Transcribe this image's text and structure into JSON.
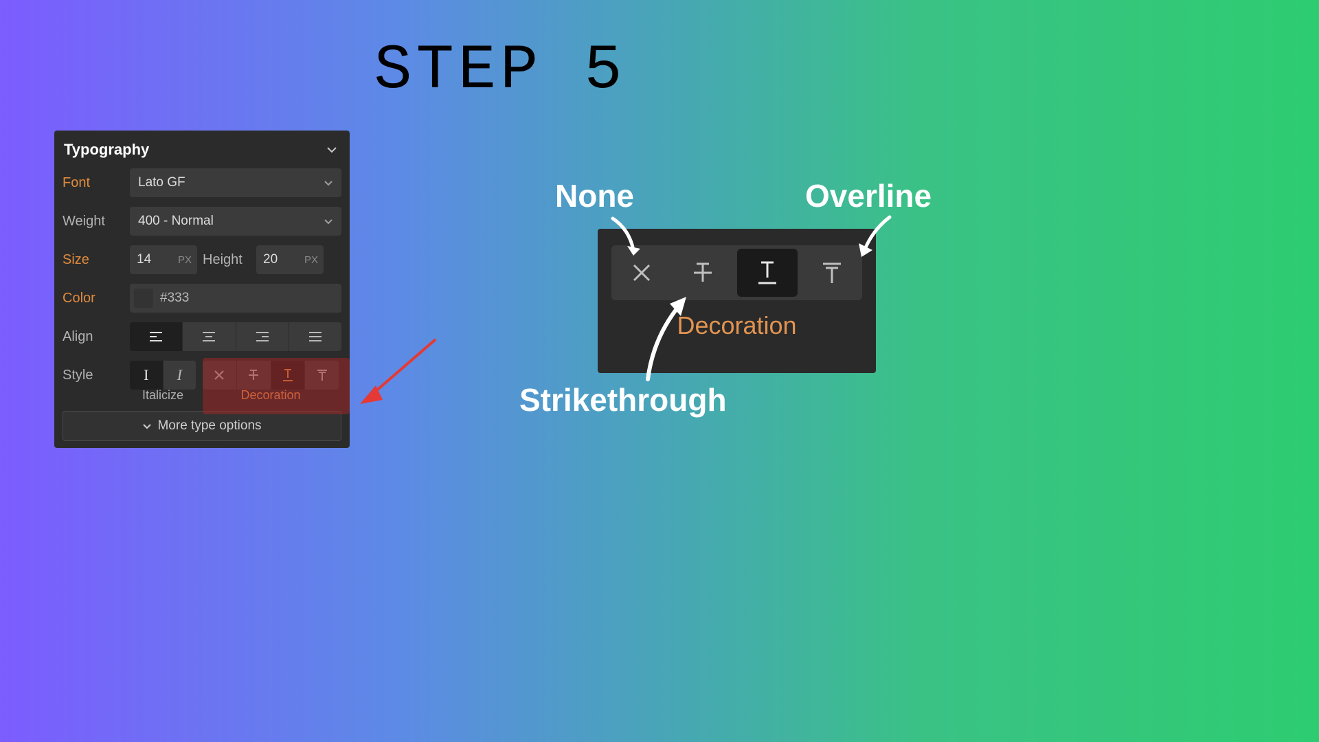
{
  "page": {
    "title": "STEP 5"
  },
  "panel": {
    "title": "Typography",
    "font_label": "Font",
    "font_value": "Lato GF",
    "weight_label": "Weight",
    "weight_value": "400 - Normal",
    "size_label": "Size",
    "size_value": "14",
    "size_unit": "PX",
    "height_label": "Height",
    "height_value": "20",
    "height_unit": "PX",
    "color_label": "Color",
    "color_value": "#333",
    "align_label": "Align",
    "style_label": "Style",
    "italicize_label": "Italicize",
    "decoration_label": "Decoration",
    "more_options": "More type options"
  },
  "zoom": {
    "decoration_label": "Decoration"
  },
  "annotations": {
    "none": "None",
    "overline": "Overline",
    "strikethrough": "Strikethrough"
  }
}
